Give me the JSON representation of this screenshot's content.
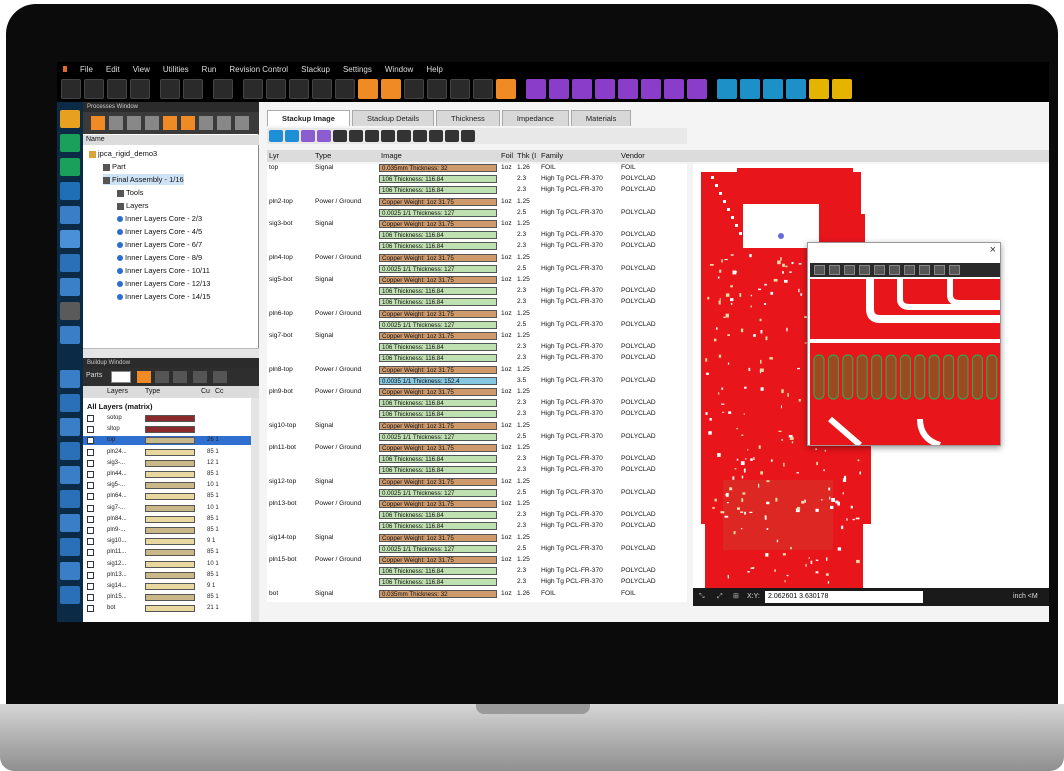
{
  "menu": [
    "File",
    "Edit",
    "View",
    "Utilities",
    "Run",
    "Revision Control",
    "Stackup",
    "Settings",
    "Window",
    "Help"
  ],
  "processes_window": {
    "title": "Processes Window",
    "name_header": "Name",
    "tree": [
      {
        "label": "jpca_rigid_demo3",
        "level": 0
      },
      {
        "label": "Part",
        "level": 1
      },
      {
        "label": "Final Assembly - 1/16",
        "level": 1,
        "selected": true
      },
      {
        "label": "Tools",
        "level": 2
      },
      {
        "label": "Layers",
        "level": 2
      },
      {
        "label": "Inner Layers Core - 2/3",
        "level": 2
      },
      {
        "label": "Inner Layers Core - 4/5",
        "level": 2
      },
      {
        "label": "Inner Layers Core - 6/7",
        "level": 2
      },
      {
        "label": "Inner Layers Core - 8/9",
        "level": 2
      },
      {
        "label": "Inner Layers Core - 10/11",
        "level": 2
      },
      {
        "label": "Inner Layers Core - 12/13",
        "level": 2
      },
      {
        "label": "Inner Layers Core - 14/15",
        "level": 2
      }
    ]
  },
  "buildup_window": {
    "title": "Buildup Window",
    "parts_label": "Parts",
    "col_layers": "Layers",
    "col_type": "Type",
    "col_cu": "Cu",
    "col_c": "Cc",
    "all_layers": "All Layers (matrix)",
    "layers": [
      {
        "name": "sotop",
        "num": ""
      },
      {
        "name": "sltop",
        "num": ""
      },
      {
        "name": "top",
        "num": "26 1"
      },
      {
        "name": "pln24...",
        "num": "85 1"
      },
      {
        "name": "sig3-...",
        "num": "12 1"
      },
      {
        "name": "pln44...",
        "num": "85 1"
      },
      {
        "name": "sig5-...",
        "num": "10 1"
      },
      {
        "name": "pln64...",
        "num": "85 1"
      },
      {
        "name": "sig7-...",
        "num": "10 1"
      },
      {
        "name": "pln84...",
        "num": "85 1"
      },
      {
        "name": "pln9-...",
        "num": "85 1"
      },
      {
        "name": "sig10...",
        "num": "9 1"
      },
      {
        "name": "pln11...",
        "num": "85 1"
      },
      {
        "name": "sig12...",
        "num": "10 1"
      },
      {
        "name": "pln13...",
        "num": "85 1"
      },
      {
        "name": "sig14...",
        "num": "9 1"
      },
      {
        "name": "pln15...",
        "num": "85 1"
      },
      {
        "name": "bot",
        "num": "21 1"
      }
    ]
  },
  "tabs": [
    "Stackup Image",
    "Stackup Details",
    "Thickness",
    "Impedance",
    "Materials"
  ],
  "grid_headers": {
    "lyr": "Lyr",
    "type": "Type",
    "image": "Image",
    "foil": "Foil",
    "thk": "Thk (I",
    "family": "Family",
    "vendor": "Vendor"
  },
  "stackup_rows": [
    {
      "lyr": "top",
      "type": "Signal",
      "image": "0.035mm Thickness: 32",
      "kind": "copper",
      "foil": "1oz",
      "thk": "1.26",
      "family": "FOIL",
      "vendor": "FOIL"
    },
    {
      "lyr": "",
      "type": "",
      "image": "106 Thickness: 116.84",
      "kind": "core",
      "foil": "",
      "thk": "2.3",
      "family": "High Tg PCL-FR-370",
      "vendor": "POLYCLAD"
    },
    {
      "lyr": "",
      "type": "",
      "image": "106 Thickness: 116.84",
      "kind": "core",
      "foil": "",
      "thk": "2.3",
      "family": "High Tg PCL-FR-370",
      "vendor": "POLYCLAD"
    },
    {
      "lyr": "pln2-top",
      "type": "Power / Ground",
      "image": "Copper Weight: 1oz 31.75",
      "kind": "copper",
      "foil": "1oz",
      "thk": "1.25",
      "family": "",
      "vendor": ""
    },
    {
      "lyr": "",
      "type": "",
      "image": "0.0025 1/1 Thickness: 127",
      "kind": "core",
      "foil": "",
      "thk": "2.5",
      "family": "High Tg PCL-FR-370",
      "vendor": "POLYCLAD"
    },
    {
      "lyr": "sig3-bot",
      "type": "Signal",
      "image": "Copper Weight: 1oz 31.75",
      "kind": "copper",
      "foil": "1oz",
      "thk": "1.25",
      "family": "",
      "vendor": ""
    },
    {
      "lyr": "",
      "type": "",
      "image": "106 Thickness: 116.84",
      "kind": "core",
      "foil": "",
      "thk": "2.3",
      "family": "High Tg PCL-FR-370",
      "vendor": "POLYCLAD"
    },
    {
      "lyr": "",
      "type": "",
      "image": "106 Thickness: 116.84",
      "kind": "core",
      "foil": "",
      "thk": "2.3",
      "family": "High Tg PCL-FR-370",
      "vendor": "POLYCLAD"
    },
    {
      "lyr": "pln4-top",
      "type": "Power / Ground",
      "image": "Copper Weight: 1oz 31.75",
      "kind": "copper",
      "foil": "1oz",
      "thk": "1.25",
      "family": "",
      "vendor": ""
    },
    {
      "lyr": "",
      "type": "",
      "image": "0.0025 1/1 Thickness: 127",
      "kind": "core",
      "foil": "",
      "thk": "2.5",
      "family": "High Tg PCL-FR-370",
      "vendor": "POLYCLAD"
    },
    {
      "lyr": "sig5-bot",
      "type": "Signal",
      "image": "Copper Weight: 1oz 31.75",
      "kind": "copper",
      "foil": "1oz",
      "thk": "1.25",
      "family": "",
      "vendor": ""
    },
    {
      "lyr": "",
      "type": "",
      "image": "106 Thickness: 116.84",
      "kind": "core",
      "foil": "",
      "thk": "2.3",
      "family": "High Tg PCL-FR-370",
      "vendor": "POLYCLAD"
    },
    {
      "lyr": "",
      "type": "",
      "image": "106 Thickness: 116.84",
      "kind": "core",
      "foil": "",
      "thk": "2.3",
      "family": "High Tg PCL-FR-370",
      "vendor": "POLYCLAD"
    },
    {
      "lyr": "pln6-top",
      "type": "Power / Ground",
      "image": "Copper Weight: 1oz 31.75",
      "kind": "copper",
      "foil": "1oz",
      "thk": "1.25",
      "family": "",
      "vendor": ""
    },
    {
      "lyr": "",
      "type": "",
      "image": "0.0025 1/1 Thickness: 127",
      "kind": "core",
      "foil": "",
      "thk": "2.5",
      "family": "High Tg PCL-FR-370",
      "vendor": "POLYCLAD"
    },
    {
      "lyr": "sig7-bot",
      "type": "Signal",
      "image": "Copper Weight: 1oz 31.75",
      "kind": "copper",
      "foil": "1oz",
      "thk": "1.25",
      "family": "",
      "vendor": ""
    },
    {
      "lyr": "",
      "type": "",
      "image": "106 Thickness: 116.84",
      "kind": "core",
      "foil": "",
      "thk": "2.3",
      "family": "High Tg PCL-FR-370",
      "vendor": "POLYCLAD"
    },
    {
      "lyr": "",
      "type": "",
      "image": "106 Thickness: 116.84",
      "kind": "core",
      "foil": "",
      "thk": "2.3",
      "family": "High Tg PCL-FR-370",
      "vendor": "POLYCLAD"
    },
    {
      "lyr": "pln8-top",
      "type": "Power / Ground",
      "image": "Copper Weight: 1oz 31.75",
      "kind": "copper",
      "foil": "1oz",
      "thk": "1.25",
      "family": "",
      "vendor": ""
    },
    {
      "lyr": "",
      "type": "",
      "image": "0.0035 1/1 Thickness: 152.4",
      "kind": "prepreg",
      "foil": "",
      "thk": "3.5",
      "family": "High Tg PCL-FR-370",
      "vendor": "POLYCLAD"
    },
    {
      "lyr": "pln9-bot",
      "type": "Power / Ground",
      "image": "Copper Weight: 1oz 31.75",
      "kind": "copper",
      "foil": "1oz",
      "thk": "1.25",
      "family": "",
      "vendor": ""
    },
    {
      "lyr": "",
      "type": "",
      "image": "106 Thickness: 116.84",
      "kind": "core",
      "foil": "",
      "thk": "2.3",
      "family": "High Tg PCL-FR-370",
      "vendor": "POLYCLAD"
    },
    {
      "lyr": "",
      "type": "",
      "image": "106 Thickness: 116.84",
      "kind": "core",
      "foil": "",
      "thk": "2.3",
      "family": "High Tg PCL-FR-370",
      "vendor": "POLYCLAD"
    },
    {
      "lyr": "sig10-top",
      "type": "Signal",
      "image": "Copper Weight: 1oz 31.75",
      "kind": "copper",
      "foil": "1oz",
      "thk": "1.25",
      "family": "",
      "vendor": ""
    },
    {
      "lyr": "",
      "type": "",
      "image": "0.0025 1/1 Thickness: 127",
      "kind": "core",
      "foil": "",
      "thk": "2.5",
      "family": "High Tg PCL-FR-370",
      "vendor": "POLYCLAD"
    },
    {
      "lyr": "pln11-bot",
      "type": "Power / Ground",
      "image": "Copper Weight: 1oz 31.75",
      "kind": "copper",
      "foil": "1oz",
      "thk": "1.25",
      "family": "",
      "vendor": ""
    },
    {
      "lyr": "",
      "type": "",
      "image": "106 Thickness: 116.84",
      "kind": "core",
      "foil": "",
      "thk": "2.3",
      "family": "High Tg PCL-FR-370",
      "vendor": "POLYCLAD"
    },
    {
      "lyr": "",
      "type": "",
      "image": "106 Thickness: 116.84",
      "kind": "core",
      "foil": "",
      "thk": "2.3",
      "family": "High Tg PCL-FR-370",
      "vendor": "POLYCLAD"
    },
    {
      "lyr": "sig12-top",
      "type": "Signal",
      "image": "Copper Weight: 1oz 31.75",
      "kind": "copper",
      "foil": "1oz",
      "thk": "1.25",
      "family": "",
      "vendor": ""
    },
    {
      "lyr": "",
      "type": "",
      "image": "0.0025 1/1 Thickness: 127",
      "kind": "core",
      "foil": "",
      "thk": "2.5",
      "family": "High Tg PCL-FR-370",
      "vendor": "POLYCLAD"
    },
    {
      "lyr": "pln13-bot",
      "type": "Power / Ground",
      "image": "Copper Weight: 1oz 31.75",
      "kind": "copper",
      "foil": "1oz",
      "thk": "1.25",
      "family": "",
      "vendor": ""
    },
    {
      "lyr": "",
      "type": "",
      "image": "106 Thickness: 116.84",
      "kind": "core",
      "foil": "",
      "thk": "2.3",
      "family": "High Tg PCL-FR-370",
      "vendor": "POLYCLAD"
    },
    {
      "lyr": "",
      "type": "",
      "image": "106 Thickness: 116.84",
      "kind": "core",
      "foil": "",
      "thk": "2.3",
      "family": "High Tg PCL-FR-370",
      "vendor": "POLYCLAD"
    },
    {
      "lyr": "sig14-top",
      "type": "Signal",
      "image": "Copper Weight: 1oz 31.75",
      "kind": "copper",
      "foil": "1oz",
      "thk": "1.25",
      "family": "",
      "vendor": ""
    },
    {
      "lyr": "",
      "type": "",
      "image": "0.0025 1/1 Thickness: 127",
      "kind": "core",
      "foil": "",
      "thk": "2.5",
      "family": "High Tg PCL-FR-370",
      "vendor": "POLYCLAD"
    },
    {
      "lyr": "pln15-bot",
      "type": "Power / Ground",
      "image": "Copper Weight: 1oz 31.75",
      "kind": "copper",
      "foil": "1oz",
      "thk": "1.25",
      "family": "",
      "vendor": ""
    },
    {
      "lyr": "",
      "type": "",
      "image": "106 Thickness: 116.84",
      "kind": "core",
      "foil": "",
      "thk": "2.3",
      "family": "High Tg PCL-FR-370",
      "vendor": "POLYCLAD"
    },
    {
      "lyr": "",
      "type": "",
      "image": "106 Thickness: 116.84",
      "kind": "core",
      "foil": "",
      "thk": "2.3",
      "family": "High Tg PCL-FR-370",
      "vendor": "POLYCLAD"
    },
    {
      "lyr": "bot",
      "type": "Signal",
      "image": "0.035mm Thickness: 32",
      "kind": "copper",
      "foil": "1oz",
      "thk": "1.26",
      "family": "FOIL",
      "vendor": "FOIL"
    }
  ],
  "statusbar": {
    "xy_label": "X:Y:",
    "coords": "2.062601 3.630178",
    "units": "inch <M"
  },
  "colors": {
    "pcb_red": "#e8151b",
    "copper_pad": "#9c4a22",
    "pad_outline": "#2fa84a"
  }
}
